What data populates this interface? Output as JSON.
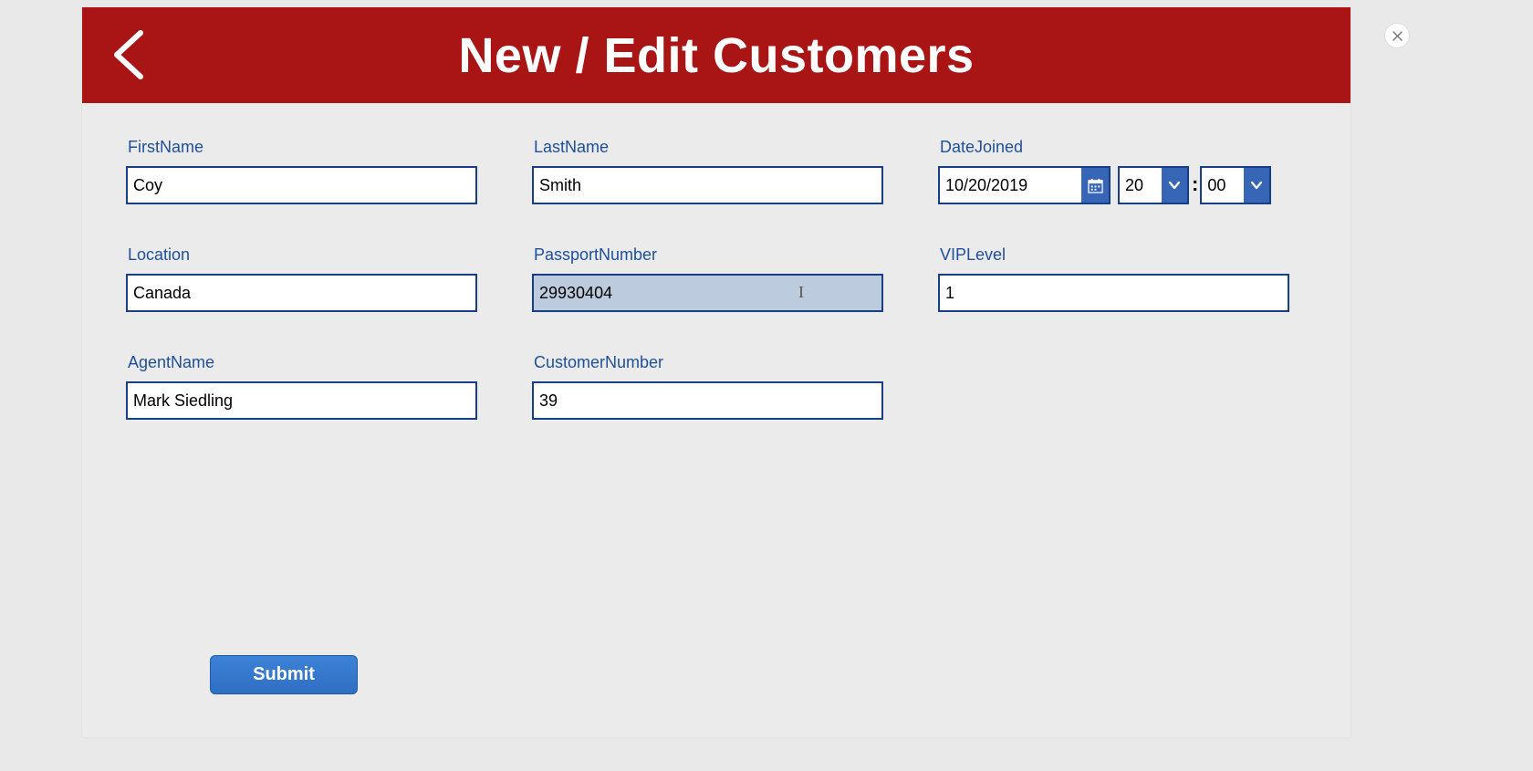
{
  "header": {
    "title": "New / Edit Customers"
  },
  "fields": {
    "firstName": {
      "label": "FirstName",
      "value": "Coy"
    },
    "lastName": {
      "label": "LastName",
      "value": "Smith"
    },
    "dateJoined": {
      "label": "DateJoined",
      "date": "10/20/2019",
      "hour": "20",
      "colon": ":",
      "minute": "00"
    },
    "location": {
      "label": "Location",
      "value": "Canada"
    },
    "passportNumber": {
      "label": "PassportNumber",
      "value": "29930404"
    },
    "vipLevel": {
      "label": "VIPLevel",
      "value": "1"
    },
    "agentName": {
      "label": "AgentName",
      "value": "Mark Siedling"
    },
    "customerNumber": {
      "label": "CustomerNumber",
      "value": "39"
    }
  },
  "buttons": {
    "submit": "Submit"
  },
  "colors": {
    "headerBg": "#a91414",
    "fieldBorder": "#163f86",
    "labelColor": "#1e4f9a",
    "accentBlue": "#3766b6",
    "submitBlue": "#2e6fc3",
    "selectedBg": "#bcccde"
  }
}
